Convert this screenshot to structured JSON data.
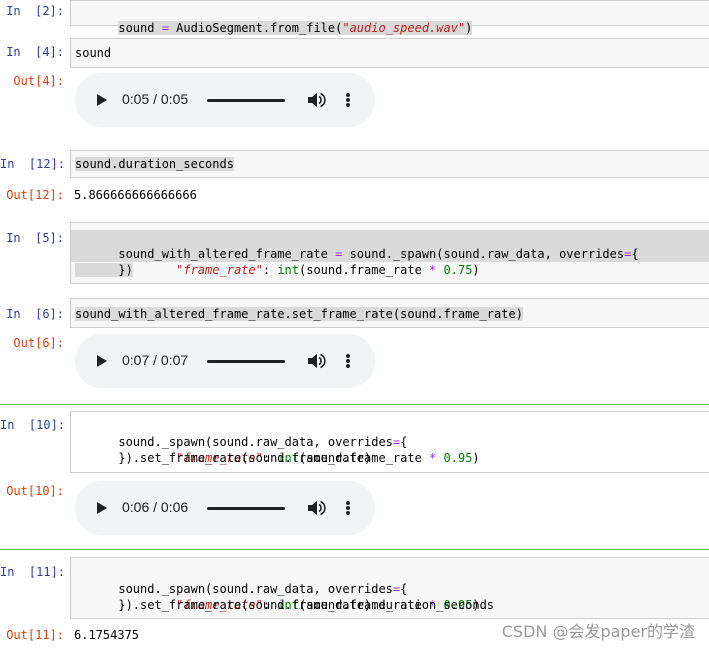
{
  "cells": [
    {
      "in_prompt": "In  [2]:",
      "code": [
        [
          "sound ",
          "=",
          " AudioSegment.from_file(",
          "\"audio_speed.wav\"",
          ")"
        ]
      ]
    },
    {
      "in_prompt": "In  [4]:",
      "code_text": "sound",
      "out_prompt": "Out[4]:",
      "player": {
        "time": "0:05 / 0:05"
      }
    },
    {
      "in_prompt": "In  [12]:",
      "code_text": "sound.duration_seconds",
      "out_prompt": "Out[12]:",
      "output": "5.866666666666666"
    },
    {
      "in_prompt": "In  [5]:",
      "lines": [
        "sound_with_altered_frame_rate = sound._spawn(sound.raw_data, overrides={",
        "        \"frame_rate\": int(sound.frame_rate * 0.75)",
        "      })"
      ]
    },
    {
      "in_prompt": "In  [6]:",
      "code_text": "sound_with_altered_frame_rate.set_frame_rate(sound.frame_rate)",
      "out_prompt": "Out[6]:",
      "player": {
        "time": "0:07 / 0:07"
      }
    },
    {
      "in_prompt": "In  [10]:",
      "lines": [
        "sound._spawn(sound.raw_data, overrides={",
        "        \"frame_rate\": int(sound.frame_rate * 0.95)",
        "      }).set_frame_rate(sound.frame_rate)"
      ],
      "out_prompt": "Out[10]:",
      "player": {
        "time": "0:06 / 0:06"
      }
    },
    {
      "in_prompt": "In  [11]:",
      "lines": [
        "sound._spawn(sound.raw_data, overrides={",
        "        \"frame_rate\": int(sound.frame_rate * 0.95)",
        "      }).set_frame_rate(sound.frame_rate).duration_seconds"
      ],
      "out_prompt": "Out[11]:",
      "output": "6.1754375"
    }
  ],
  "code_parts": {
    "c2_a": "sound ",
    "c2_op": "=",
    "c2_b": " AudioSegment.from_file(",
    "c2_str": "\"audio_speed.wav\"",
    "c2_c": ")",
    "c5_l1_a": "sound_with_altered_frame_rate ",
    "c5_l1_op": "=",
    "c5_l1_b": " sound._spawn(sound.raw_data, overrides",
    "c5_l1_op2": "=",
    "c5_l1_c": "{",
    "l2_indent": "        ",
    "l2_str": "\"frame_rate\"",
    "l2_colon": ": ",
    "l2_int": "int",
    "l2_mid": "(sound.frame_rate ",
    "l2_op": "*",
    "l2_sp": " ",
    "l2_num_075": "0.75",
    "l2_num_095": "0.95",
    "l2_close": ")",
    "c5_l3": "      })",
    "c10_l1_a": "sound._spawn(sound.raw_data, overrides",
    "c10_l1_op": "=",
    "c10_l1_b": "{",
    "c10_l3": "      }).set_frame_rate(sound.frame_rate)",
    "c11_l3": "      }).set_frame_rate(sound.frame_rate).duration_seconds"
  },
  "watermark": "CSDN @会发paper的学渣",
  "colors": {
    "in_prompt": "#303f9f",
    "out_prompt": "#d84315",
    "string": "#ba2121",
    "operator": "#aa22ff",
    "builtin": "#008000",
    "selected_border": "#66bb6a"
  }
}
